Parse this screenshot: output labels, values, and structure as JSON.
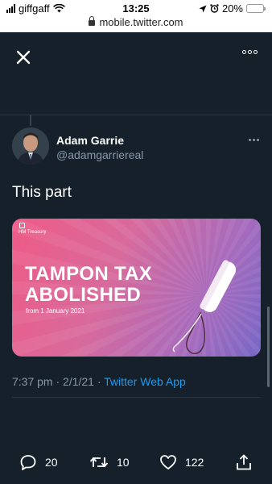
{
  "statusbar": {
    "carrier": "giffgaff",
    "time": "13:25",
    "battery": "20%",
    "battery_level": 0.2
  },
  "browser": {
    "url": "mobile.twitter.com"
  },
  "tweet": {
    "author_name": "Adam Garrie",
    "author_handle": "@adamgarriereal",
    "text": "This part",
    "timestamp": "7:37 pm · 2/1/21 · ",
    "source": "Twitter Web App",
    "media": {
      "org": "HM Treasury",
      "headline_line1": "TAMPON TAX",
      "headline_line2": "ABOLISHED",
      "subtext": "from 1 January 2021"
    },
    "replies": "20",
    "retweets": "10",
    "likes": "122"
  }
}
